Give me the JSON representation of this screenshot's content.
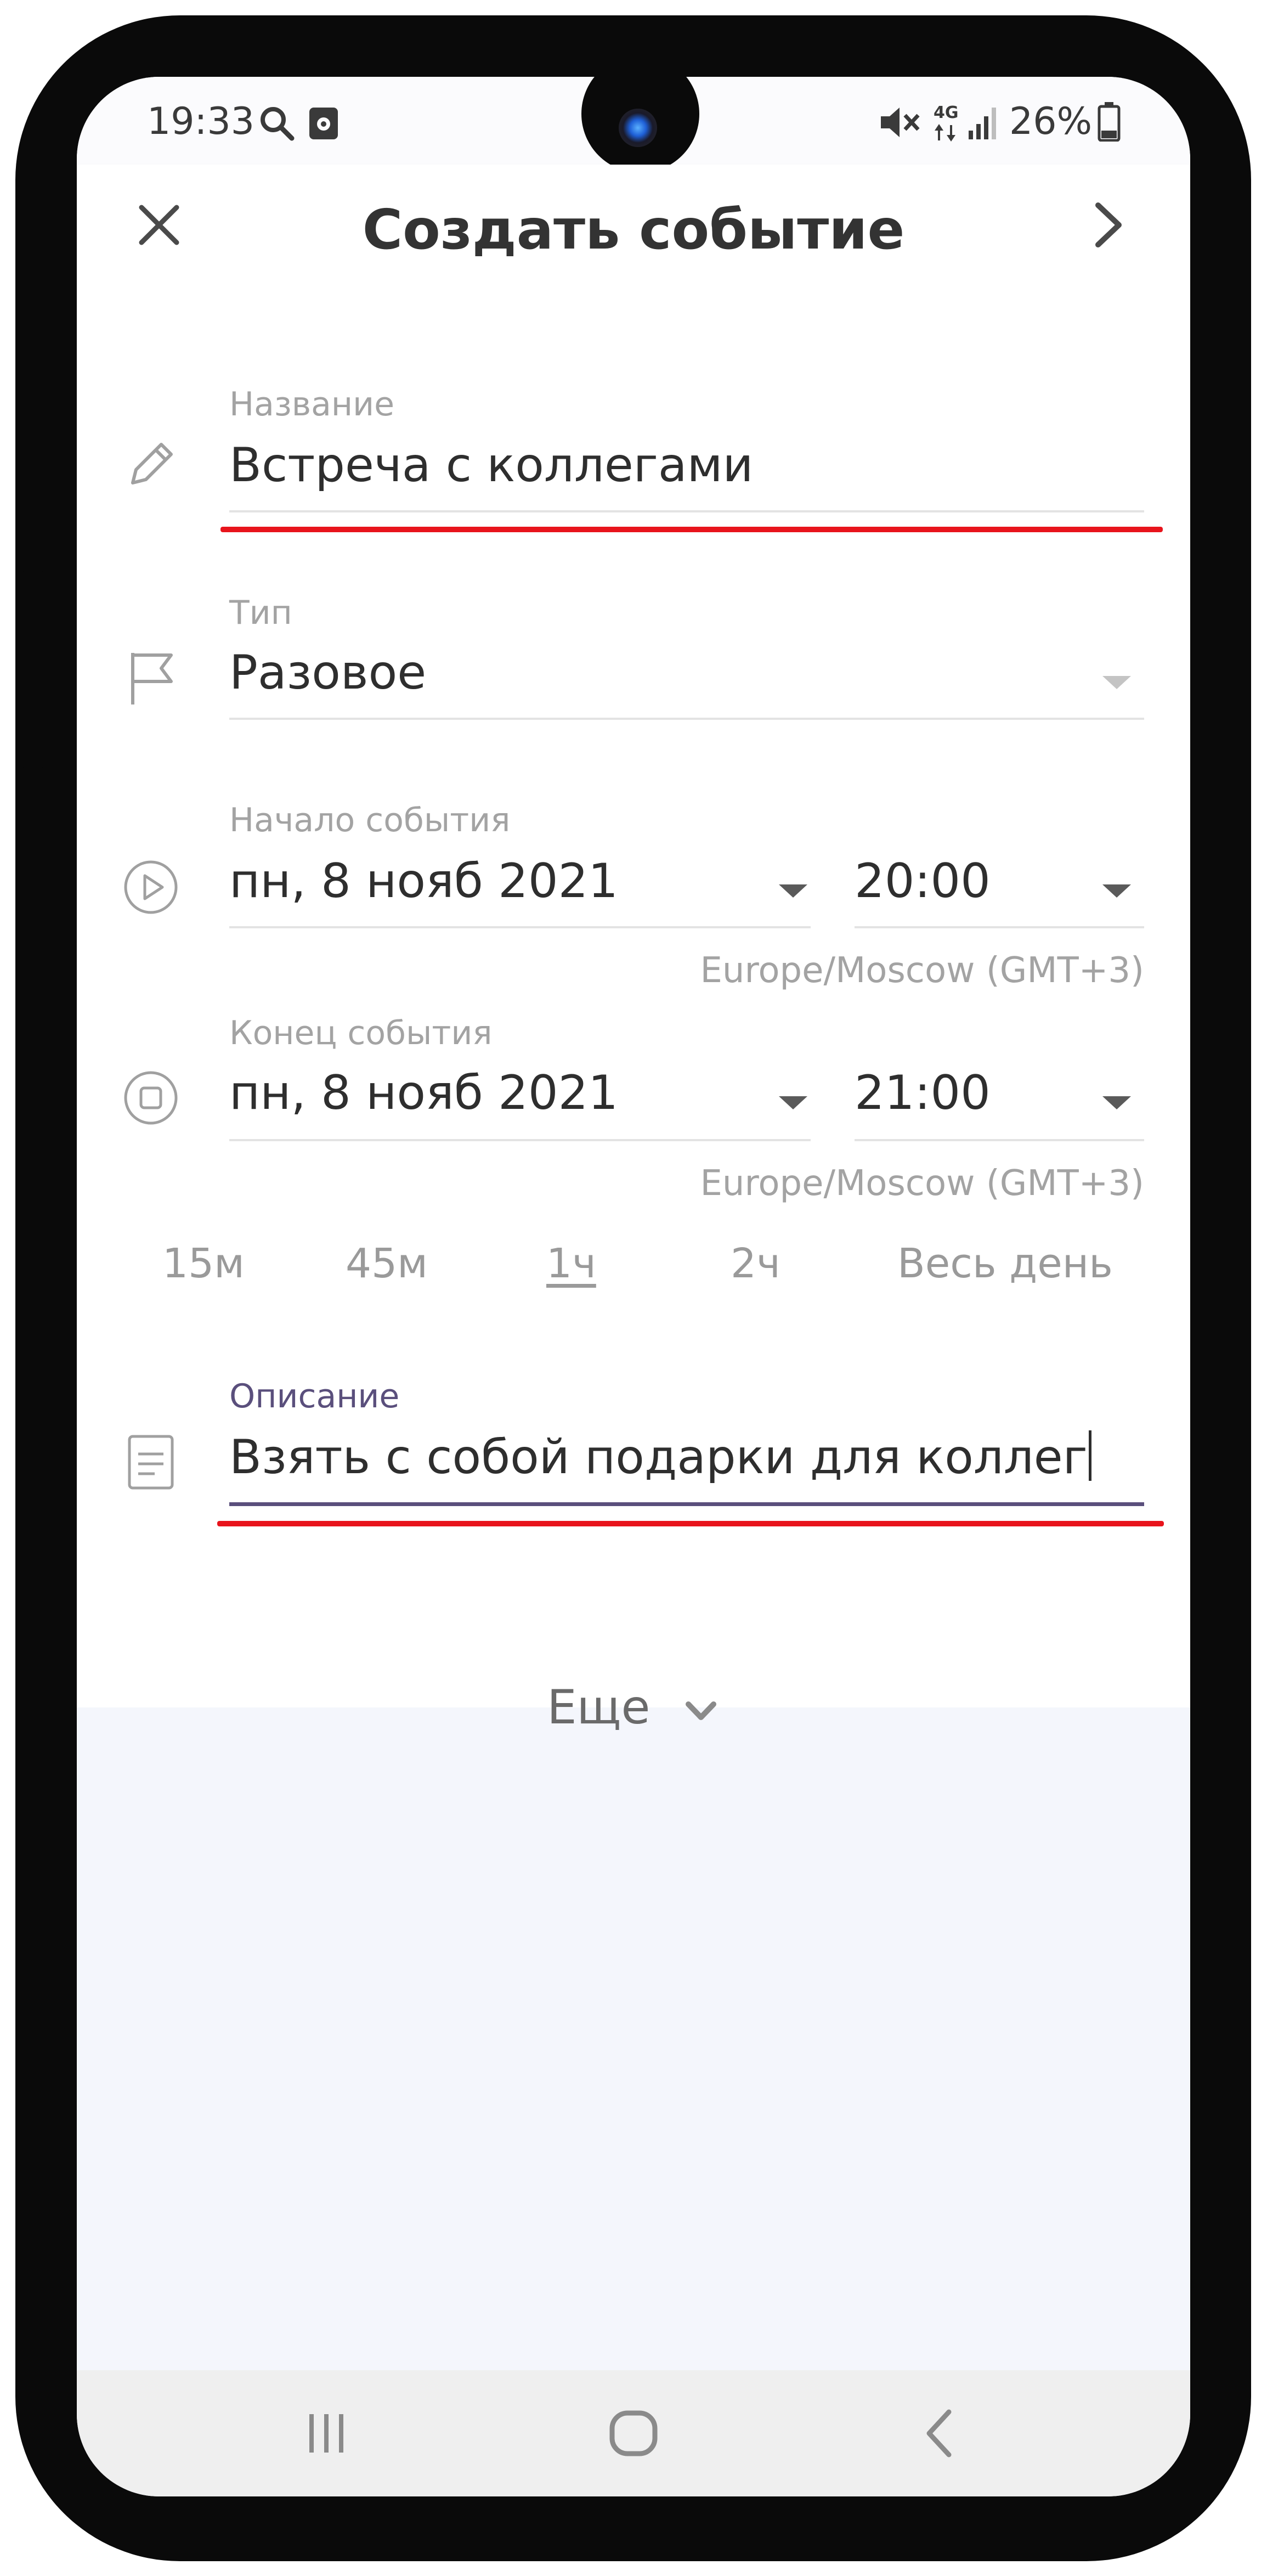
{
  "status_bar": {
    "time": "19:33",
    "network": "4G",
    "battery": "26%"
  },
  "header": {
    "title": "Создать событие",
    "close_icon": "close-icon",
    "next_icon": "chevron-right-icon"
  },
  "fields": {
    "name": {
      "label": "Название",
      "value": "Встреча с коллегами",
      "icon": "pencil-icon"
    },
    "type": {
      "label": "Тип",
      "value": "Разовое",
      "icon": "flag-icon"
    },
    "start": {
      "label": "Начало события",
      "date": "пн, 8 нояб 2021",
      "time": "20:00",
      "timezone": "Europe/Moscow (GMT+3)",
      "icon": "play-circle-icon"
    },
    "end": {
      "label": "Конец события",
      "date": "пн, 8 нояб 2021",
      "time": "21:00",
      "timezone": "Europe/Moscow (GMT+3)",
      "icon": "stop-circle-icon"
    },
    "description": {
      "label": "Описание",
      "value": "Взять с собой подарки для коллег",
      "icon": "document-icon"
    }
  },
  "durations": [
    {
      "label": "15м",
      "active": false
    },
    {
      "label": "45м",
      "active": false
    },
    {
      "label": "1ч",
      "active": true
    },
    {
      "label": "2ч",
      "active": false
    },
    {
      "label": "Весь день",
      "active": false
    }
  ],
  "more": {
    "label": "Еще"
  },
  "colors": {
    "accent_underline": "#5a4f7c",
    "annotation_red": "#e8141c",
    "text_primary": "#2e2e2e",
    "text_secondary": "#a3a3a3"
  }
}
